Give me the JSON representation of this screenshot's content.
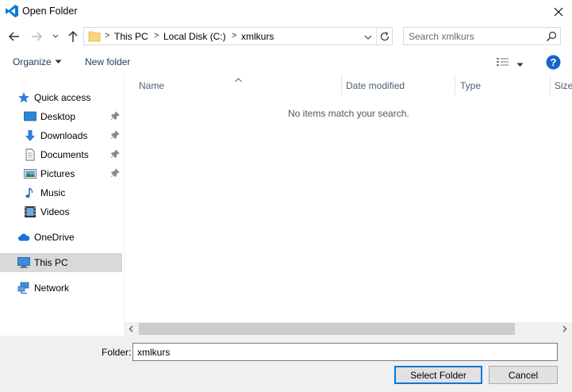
{
  "window": {
    "title": "Open Folder"
  },
  "address": {
    "crumbs": [
      "This PC",
      "Local Disk (C:)",
      "xmlkurs"
    ]
  },
  "search": {
    "placeholder": "Search xmlkurs"
  },
  "toolbar": {
    "organize_label": "Organize",
    "new_folder_label": "New folder"
  },
  "nav_pane": {
    "items": [
      {
        "label": "Quick access",
        "icon": "star-icon"
      },
      {
        "label": "Desktop",
        "icon": "desktop-icon",
        "pinned": true
      },
      {
        "label": "Downloads",
        "icon": "download-icon",
        "pinned": true
      },
      {
        "label": "Documents",
        "icon": "document-icon",
        "pinned": true
      },
      {
        "label": "Pictures",
        "icon": "pictures-icon",
        "pinned": true
      },
      {
        "label": "Music",
        "icon": "music-icon"
      },
      {
        "label": "Videos",
        "icon": "video-icon"
      },
      {
        "label": "OneDrive",
        "icon": "cloud-icon"
      },
      {
        "label": "This PC",
        "icon": "computer-icon",
        "selected": true
      },
      {
        "label": "Network",
        "icon": "network-icon"
      }
    ]
  },
  "file_list": {
    "columns": [
      "Name",
      "Date modified",
      "Type",
      "Size"
    ],
    "empty_message": "No items match your search."
  },
  "bottom": {
    "folder_label": "Folder:",
    "folder_value": "xmlkurs",
    "select_label": "Select Folder",
    "cancel_label": "Cancel"
  },
  "colors": {
    "accent": "#0078d7",
    "selected_bg": "#d9d9d9",
    "column_header": "#4c607a",
    "help_blue": "#1a64c8"
  }
}
